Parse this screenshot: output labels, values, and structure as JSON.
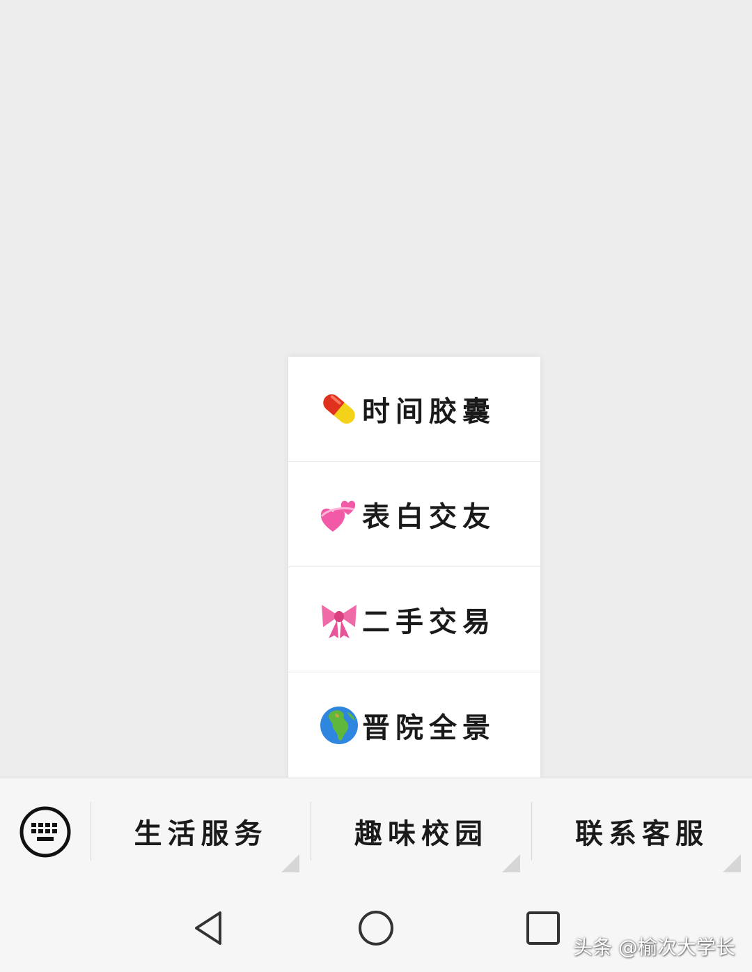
{
  "popup_menu": {
    "items": [
      {
        "emoji": "pill-emoji",
        "label": "时间胶囊"
      },
      {
        "emoji": "revolving-hearts-emoji",
        "label": "表白交友"
      },
      {
        "emoji": "ribbon-emoji",
        "label": "二手交易"
      },
      {
        "emoji": "globe-africa-emoji",
        "label": "晋院全景"
      }
    ]
  },
  "menu_bar": {
    "keyboard_icon": "keyboard-icon",
    "tabs": [
      {
        "label": "生活服务"
      },
      {
        "label": "趣味校园"
      },
      {
        "label": "联系客服"
      }
    ]
  },
  "nav_bar": {
    "buttons": [
      "back-icon",
      "home-icon",
      "recents-icon"
    ]
  },
  "watermark": "头条 @榆次大学长",
  "colors": {
    "background": "#ededed",
    "menu_bar": "#f6f6f6",
    "popup": "#ffffff",
    "text": "#1a1a1a"
  }
}
